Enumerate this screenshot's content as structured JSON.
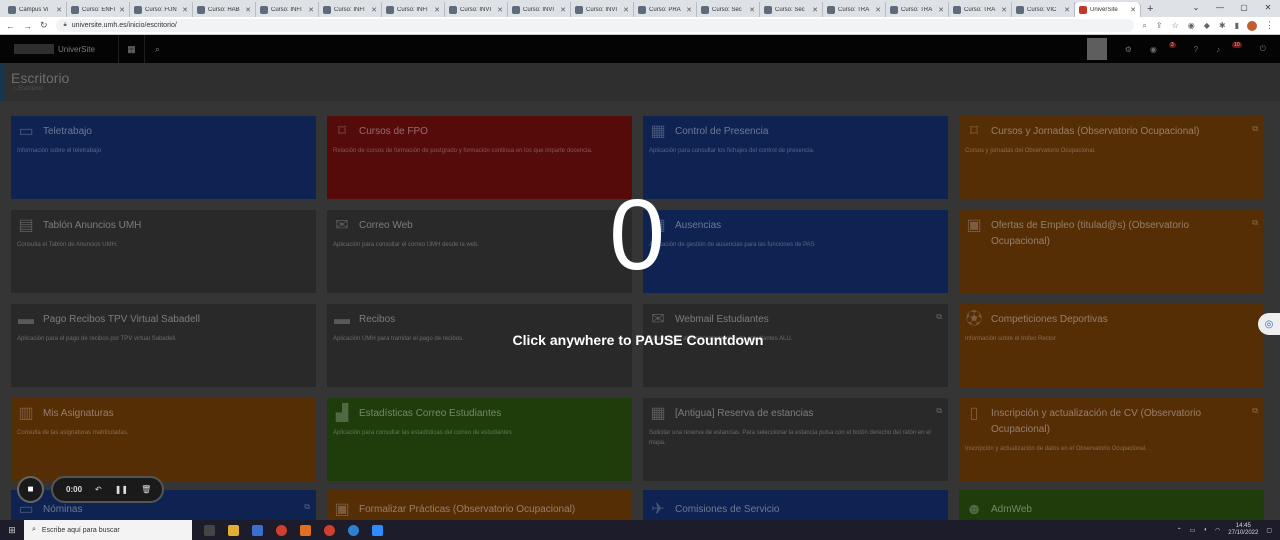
{
  "browser": {
    "tabs": [
      {
        "label": "Campus Vi"
      },
      {
        "label": "Curso: ENFI"
      },
      {
        "label": "Curso: FUN"
      },
      {
        "label": "Curso: HAB"
      },
      {
        "label": "Curso: INFI"
      },
      {
        "label": "Curso: INFI"
      },
      {
        "label": "Curso: INFI"
      },
      {
        "label": "Curso: INVI"
      },
      {
        "label": "Curso: INVI"
      },
      {
        "label": "Curso: INVI"
      },
      {
        "label": "Curso: PRA"
      },
      {
        "label": "Curso: Sec"
      },
      {
        "label": "Curso: Sec"
      },
      {
        "label": "Curso: TRA"
      },
      {
        "label": "Curso: TRA"
      },
      {
        "label": "Curso: TRA"
      },
      {
        "label": "Curso: VIC"
      }
    ],
    "active_tab": "UniverSite",
    "url": "universite.umh.es/inicio/escritorio/"
  },
  "app": {
    "brand": "UniverSite",
    "notif_badge_1": "3",
    "notif_badge_2": "10"
  },
  "page": {
    "title": "Escritorio",
    "breadcrumb": "Escritorio"
  },
  "tiles": [
    {
      "title": "Teletrabajo",
      "desc": "Información sobre el teletrabajo",
      "icon": "monitor-icon"
    },
    {
      "title": "Cursos de FPO",
      "desc": "Relación de cursos de formación de postgrado y formación continua en los que imparte docencia.",
      "icon": "bookmark-icon"
    },
    {
      "title": "Control de Presencia",
      "desc": "Aplicación para consultar los fichajes del control de presencia.",
      "icon": "calendar-icon"
    },
    {
      "title": "Cursos y Jornadas (Observatorio Ocupacional)",
      "desc": "Cursos y jornadas del Observatorio Ocupacional.",
      "icon": "bookmark-icon"
    },
    {
      "title": "Tablón Anuncios UMH",
      "desc": "Consulta el Tablón de Anuncios UMH.",
      "icon": "newspaper-icon"
    },
    {
      "title": "Correo Web",
      "desc": "Aplicación para consultar el correo UMH desde la web.",
      "icon": "envelope-icon"
    },
    {
      "title": "Ausencias",
      "desc": "Aplicación de gestión de ausencias para las funciones de PAS",
      "icon": "calendar-icon"
    },
    {
      "title": "Ofertas de Empleo (titulad@s) (Observatorio Ocupacional)",
      "desc": "",
      "icon": "briefcase-icon"
    },
    {
      "title": "Pago Recibos TPV Virtual Sabadell",
      "desc": "Aplicación para el pago de recibos por TPV virtual Sabadell.",
      "icon": "credit-card-icon"
    },
    {
      "title": "Recibos",
      "desc": "Aplicación UMH para tramitar el pago de recibos.",
      "icon": "credit-card-icon"
    },
    {
      "title": "Webmail Estudiantes",
      "desc": "Acceso web al correo electrónico de estudiantes ALU.",
      "icon": "envelope-icon"
    },
    {
      "title": "Competiciones Deportivas",
      "desc": "Información sobre el trofeo Rector",
      "icon": "soccer-ball-icon"
    },
    {
      "title": "Mis Asignaturas",
      "desc": "Consulta de las asignaturas matriculadas.",
      "icon": "books-icon"
    },
    {
      "title": "Estadísticas Correo Estudiantes",
      "desc": "Aplicación para consultar las estadísticas del correo de estudiantes",
      "icon": "bar-chart-icon"
    },
    {
      "title": "[Antigua] Reserva de estancias",
      "desc": "Solicitar una reserva de estancias. Para seleccionar la estancia pulsa con el botón derecho del ratón en el mapa.",
      "icon": "calendar-icon"
    },
    {
      "title": "Inscripción y actualización de CV (Observatorio Ocupacional)",
      "desc": "Inscripción y actualización de datos en el Observatorio Ocupacional.",
      "icon": "document-icon"
    },
    {
      "title": "Nóminas",
      "desc": "",
      "icon": "wallet-icon"
    },
    {
      "title": "Formalizar Prácticas (Observatorio Ocupacional)",
      "desc": "",
      "icon": "briefcase-icon"
    },
    {
      "title": "Comisiones de Servicio",
      "desc": "",
      "icon": "plane-icon"
    },
    {
      "title": "AdmWeb",
      "desc": "",
      "icon": "user-icon"
    }
  ],
  "overlay": {
    "countdown": "0",
    "message": "Click anywhere to PAUSE Countdown"
  },
  "recorder": {
    "time": "0:00"
  },
  "taskbar": {
    "search_placeholder": "Escribe aquí para buscar",
    "time": "14:45",
    "date": "27/10/2022"
  }
}
